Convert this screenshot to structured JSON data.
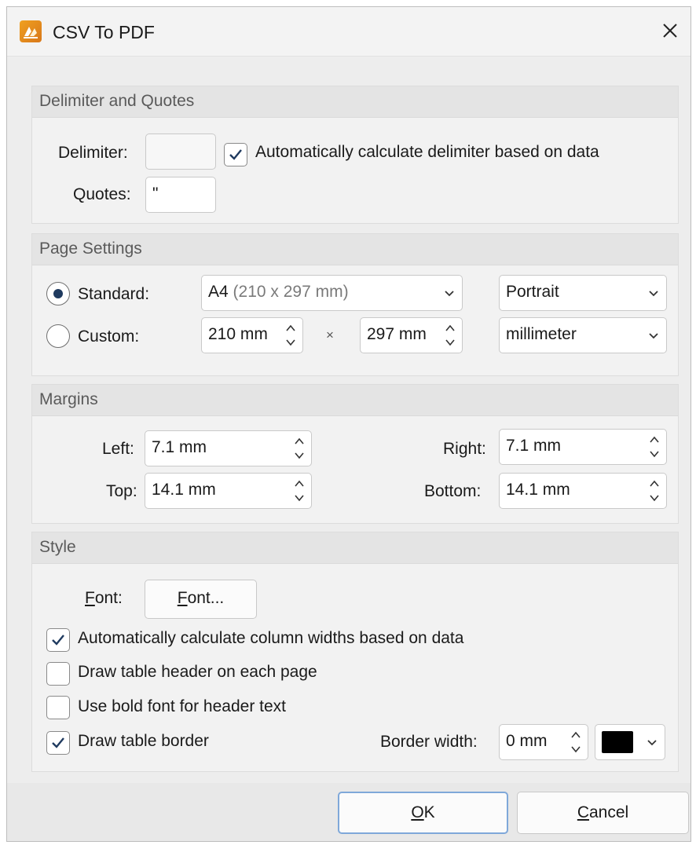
{
  "window": {
    "title": "CSV To PDF",
    "app_icon": "pdf-xchange-logo-icon",
    "close_icon": "close-icon"
  },
  "delimiter_group": {
    "header": "Delimiter and Quotes",
    "delimiter_label": "Delimiter:",
    "delimiter_value": "",
    "auto_delimiter_label": "Automatically calculate delimiter based on data",
    "auto_delimiter_checked": true,
    "quotes_label": "Quotes:",
    "quotes_value": "\""
  },
  "page_group": {
    "header": "Page Settings",
    "standard_label": "Standard:",
    "standard_selected": true,
    "paper_size_main": "A4",
    "paper_size_detail": "(210 x 297 mm)",
    "orientation": "Portrait",
    "custom_label": "Custom:",
    "custom_selected": false,
    "width_value": "210 mm",
    "times_sign": "×",
    "height_value": "297 mm",
    "units": "millimeter"
  },
  "margins_group": {
    "header": "Margins",
    "left_label": "Left:",
    "left_value": "7.1 mm",
    "right_label": "Right:",
    "right_value": "7.1 mm",
    "top_label": "Top:",
    "top_value": "14.1 mm",
    "bottom_label": "Bottom:",
    "bottom_value": "14.1 mm"
  },
  "style_group": {
    "header": "Style",
    "font_label_first": "F",
    "font_label_rest": "ont:",
    "font_button_first": "F",
    "font_button_rest": "ont...",
    "auto_widths_label": "Automatically calculate column widths based on data",
    "auto_widths_checked": true,
    "header_each_page_label": "Draw table header on each page",
    "header_each_page_checked": false,
    "bold_header_label": "Use bold font for header text",
    "bold_header_checked": false,
    "draw_border_label": "Draw table border",
    "draw_border_checked": true,
    "border_width_label": "Border width:",
    "border_width_value": "0 mm",
    "border_color": "#000000"
  },
  "footer": {
    "ok_first": "O",
    "ok_rest": "K",
    "cancel_first": "C",
    "cancel_rest": "ancel"
  },
  "colors": {
    "accent": "#1f3a5f",
    "default_button_border": "#7fa8d9"
  }
}
